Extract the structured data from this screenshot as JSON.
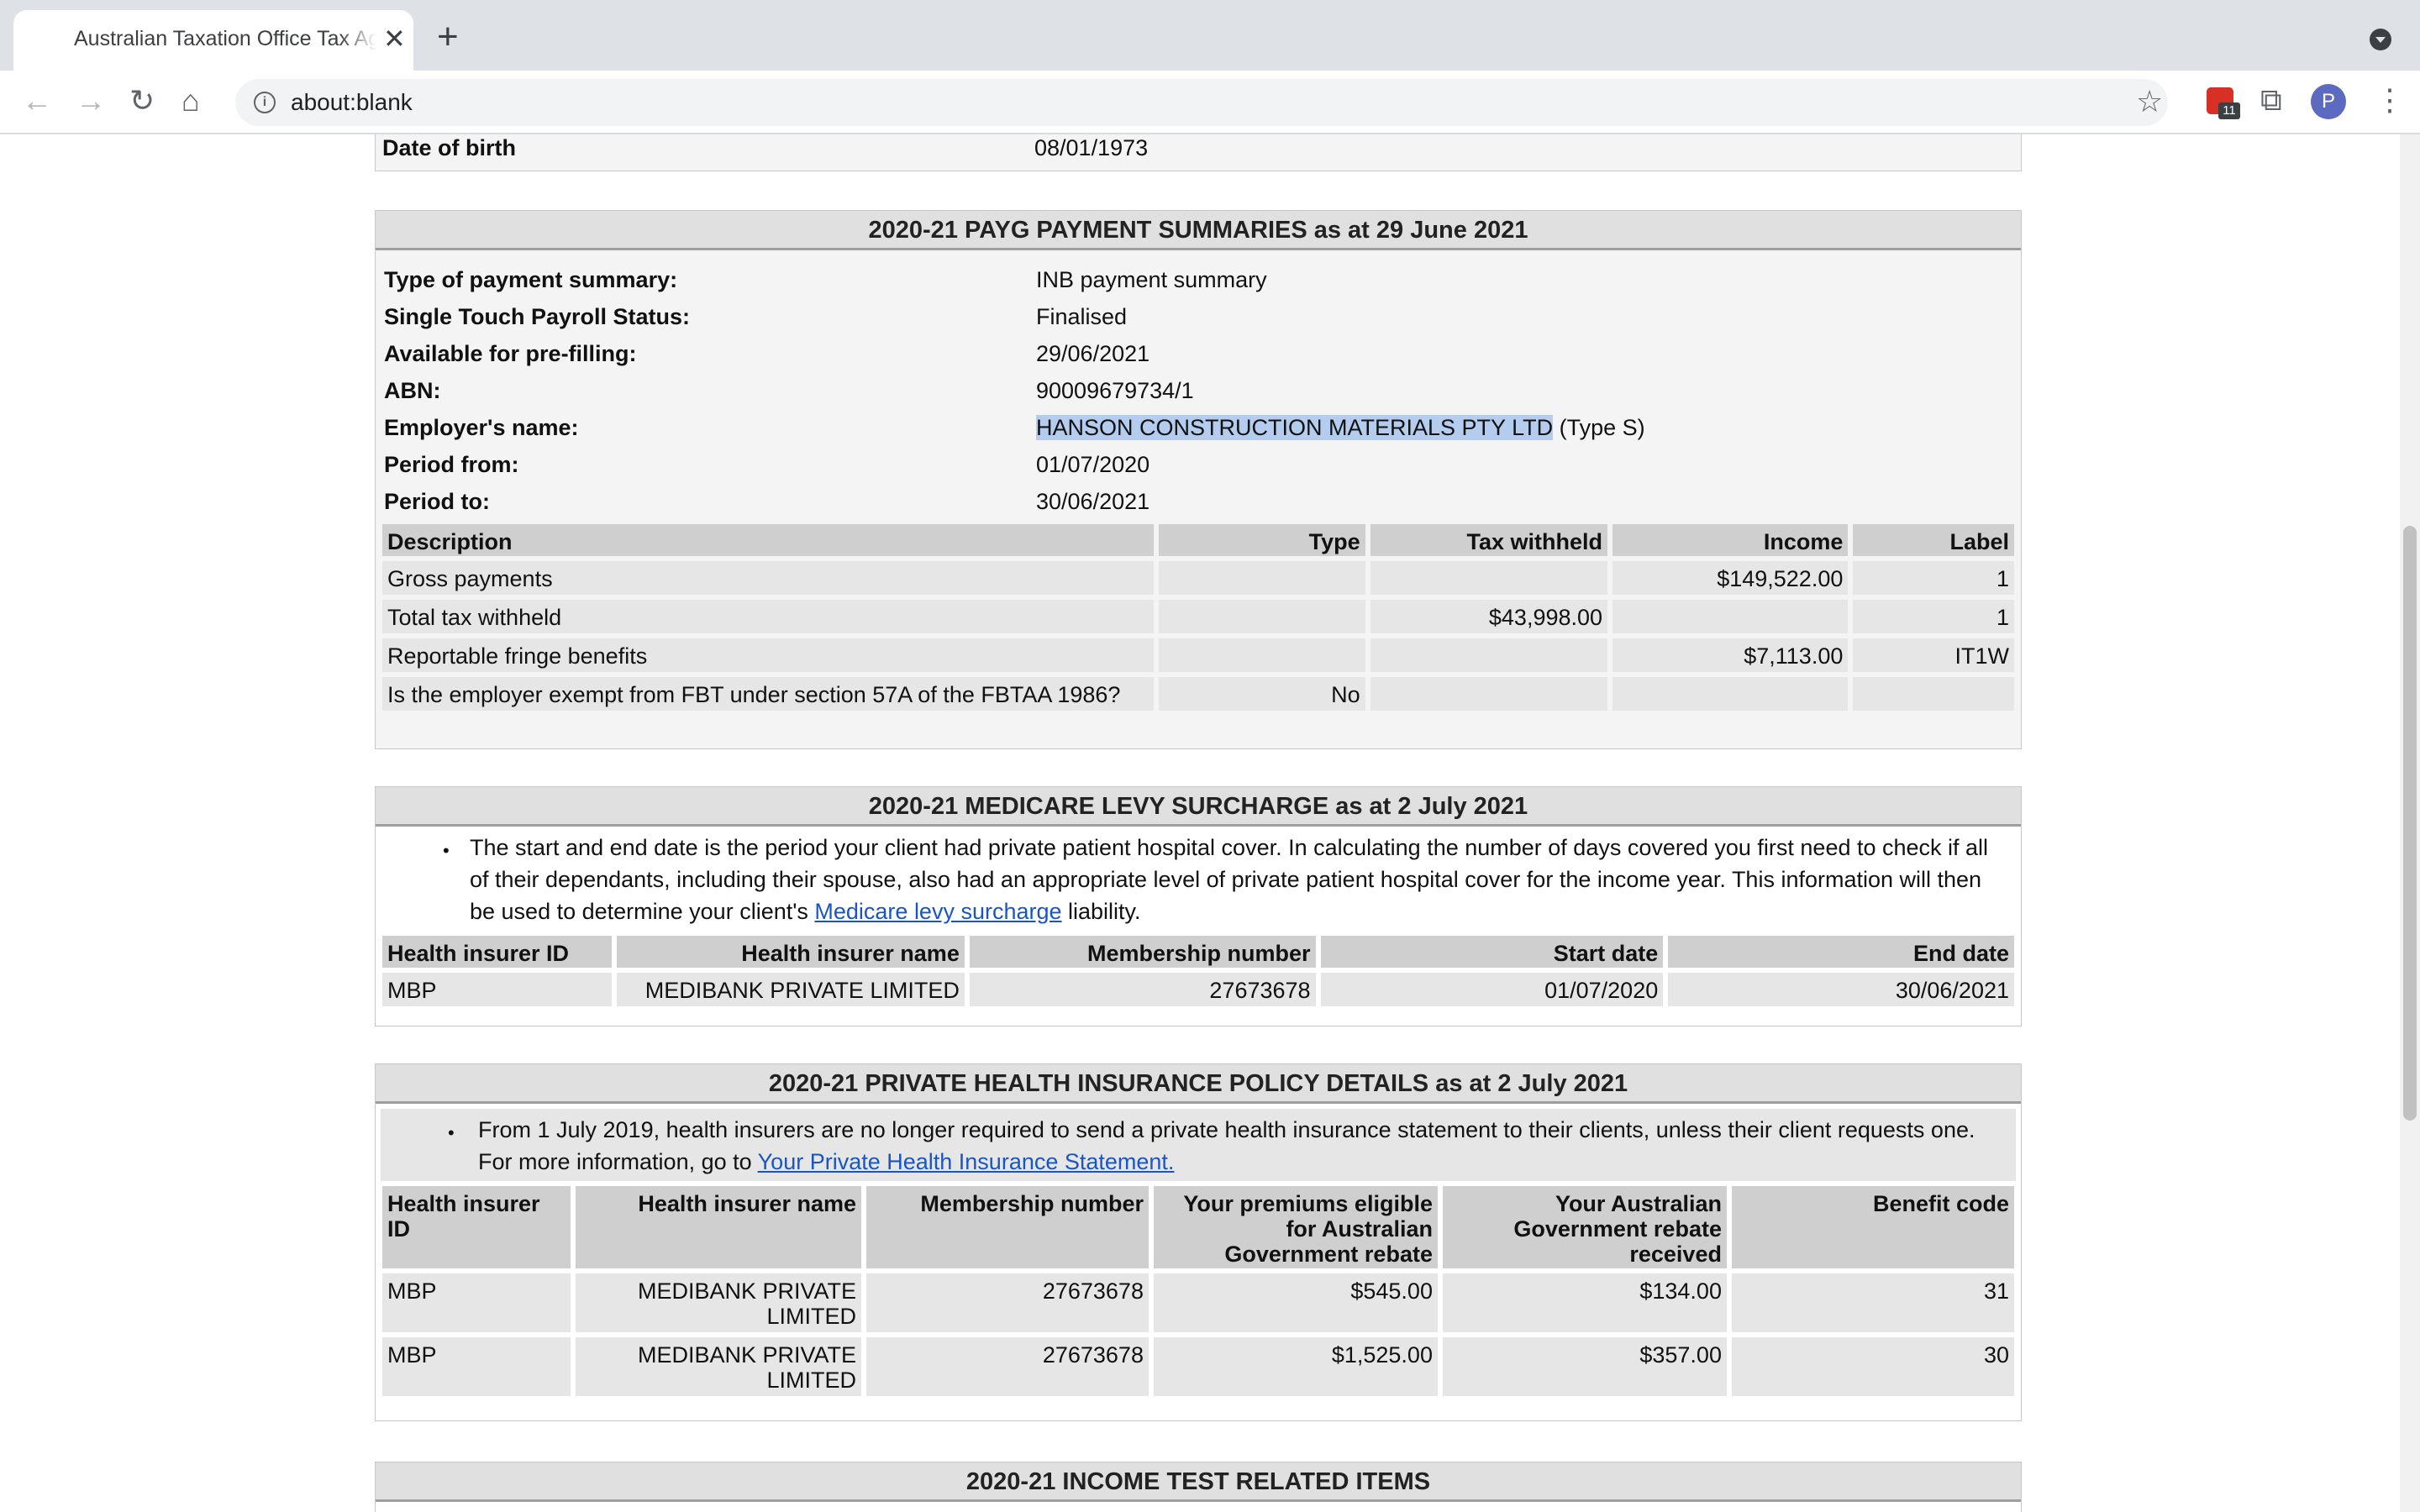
{
  "browser": {
    "tab_title": "Australian Taxation Office Tax Agent Portal",
    "tab_close": "✕",
    "new_tab": "+",
    "url": "about:blank",
    "extension_badge": "11",
    "avatar_letter": "P"
  },
  "identity": {
    "dob_label": "Date of birth",
    "dob_value": "08/01/1973"
  },
  "payg": {
    "header": "2020-21 PAYG PAYMENT SUMMARIES as at 29 June 2021",
    "fields": [
      {
        "label": "Type of payment summary:",
        "value": "INB payment summary"
      },
      {
        "label": "Single Touch Payroll Status:",
        "value": "Finalised"
      },
      {
        "label": "Available for pre-filling:",
        "value": "29/06/2021"
      },
      {
        "label": "ABN:",
        "value": "90009679734/1"
      },
      {
        "label": "Employer's name:",
        "value_highlight": "HANSON CONSTRUCTION MATERIALS PTY LTD",
        "value_suffix": " (Type S)"
      },
      {
        "label": "Period from:",
        "value": "01/07/2020"
      },
      {
        "label": "Period to:",
        "value": "30/06/2021"
      }
    ],
    "columns": [
      "Description",
      "Type",
      "Tax withheld",
      "Income",
      "Label"
    ],
    "rows": [
      [
        "Gross payments",
        "",
        "",
        "$149,522.00",
        "1"
      ],
      [
        "Total tax withheld",
        "",
        "$43,998.00",
        "",
        "1"
      ],
      [
        "Reportable fringe benefits",
        "",
        "",
        "$7,113.00",
        "IT1W"
      ],
      [
        "Is the employer exempt from FBT under section 57A of the FBTAA 1986?",
        "No",
        "",
        "",
        ""
      ]
    ]
  },
  "medicare": {
    "header": "2020-21 MEDICARE LEVY SURCHARGE as at 2 July 2021",
    "note_before": "The start and end date is the period your client had private patient hospital cover. In calculating the number of days covered you first need to check if all of their dependants, including their spouse, also had an appropriate level of private patient hospital cover for the income year. This information will then be used to determine your client's ",
    "note_link": "Medicare levy surcharge",
    "note_after": " liability.",
    "columns": [
      "Health insurer ID",
      "Health insurer name",
      "Membership number",
      "Start date",
      "End date"
    ],
    "rows": [
      [
        "MBP",
        "MEDIBANK PRIVATE LIMITED",
        "27673678",
        "01/07/2020",
        "30/06/2021"
      ]
    ]
  },
  "phi": {
    "header": "2020-21 PRIVATE HEALTH INSURANCE POLICY DETAILS as at 2 July 2021",
    "note_before": "From 1 July 2019, health insurers are no longer required to send a private health insurance statement to their clients, unless their client requests one. For more information, go to ",
    "note_link": "Your Private Health Insurance Statement.",
    "columns": [
      "Health insurer ID",
      "Health insurer name",
      "Membership number",
      "Your premiums eligible for Australian Government rebate",
      "Your Australian Government rebate received",
      "Benefit code"
    ],
    "rows": [
      [
        "MBP",
        "MEDIBANK PRIVATE LIMITED",
        "27673678",
        "$545.00",
        "$134.00",
        "31"
      ],
      [
        "MBP",
        "MEDIBANK PRIVATE LIMITED",
        "27673678",
        "$1,525.00",
        "$357.00",
        "30"
      ]
    ]
  },
  "income_test": {
    "header": "2020-21 INCOME TEST RELATED ITEMS"
  }
}
